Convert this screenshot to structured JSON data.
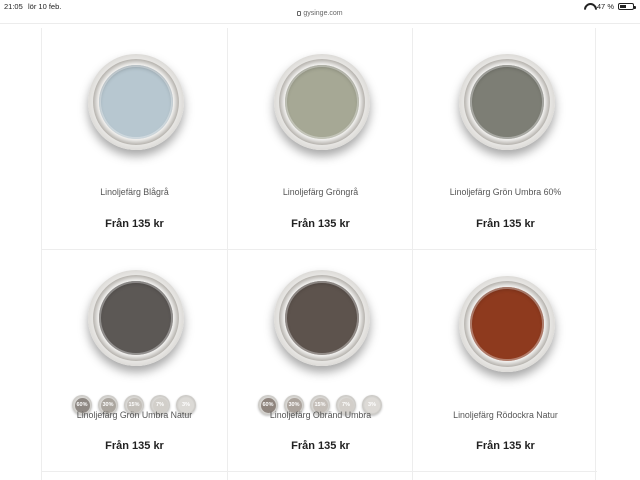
{
  "status": {
    "time": "21:05",
    "date": "lör 10 feb.",
    "url": "gysinge.com",
    "battery": "47 %",
    "battery_level_percent": 47
  },
  "products": [
    {
      "name": "Linoljefärg Blågrå",
      "price": "Från 135 kr",
      "color": "#b7c7d0",
      "chips": []
    },
    {
      "name": "Linoljefärg Gröngrå",
      "price": "Från 135 kr",
      "color": "#a6a895",
      "chips": []
    },
    {
      "name": "Linoljefärg Grön Umbra 60%",
      "price": "Från 135 kr",
      "color": "#7d7e75",
      "chips": []
    },
    {
      "name": "Linoljefärg Grön Umbra Natur",
      "price": "Från 135 kr",
      "color": "#5c5855",
      "chips": [
        {
          "label": "60%",
          "color": "#8e8883"
        },
        {
          "label": "30%",
          "color": "#aba69f"
        },
        {
          "label": "15%",
          "color": "#c3bfb9"
        },
        {
          "label": "7%",
          "color": "#d2cfca"
        },
        {
          "label": "3%",
          "color": "#dcdad6"
        }
      ]
    },
    {
      "name": "Linoljefärg Obränd Umbra",
      "price": "Från 135 kr",
      "color": "#5d534d",
      "chips": [
        {
          "label": "60%",
          "color": "#8f857e"
        },
        {
          "label": "30%",
          "color": "#aba39c"
        },
        {
          "label": "15%",
          "color": "#c4beb8"
        },
        {
          "label": "7%",
          "color": "#d3cfca"
        },
        {
          "label": "3%",
          "color": "#dddad6"
        }
      ]
    },
    {
      "name": "Linoljefärg Rödockra Natur",
      "price": "Från 135 kr",
      "color": "#8e3a1e",
      "chips": []
    }
  ]
}
